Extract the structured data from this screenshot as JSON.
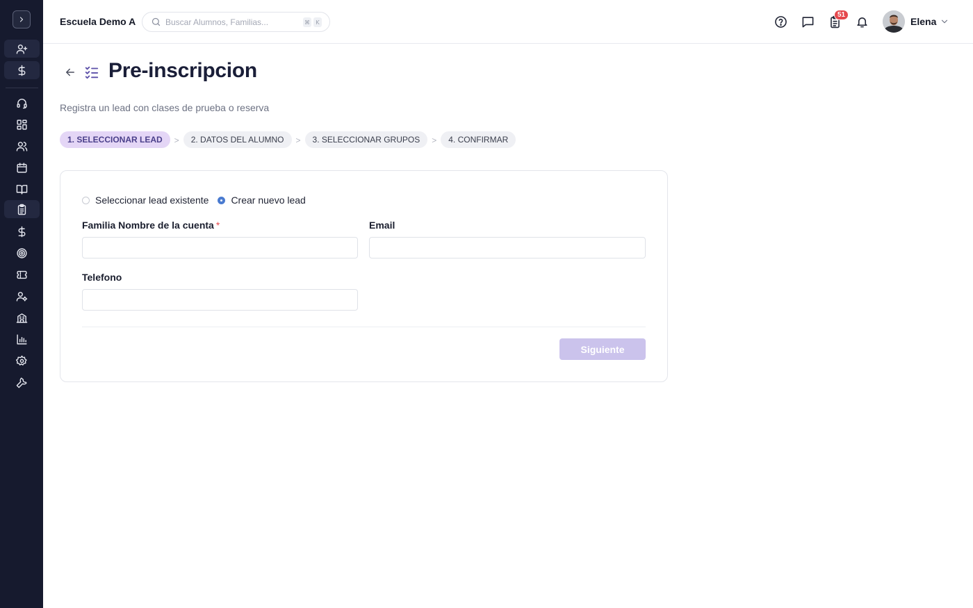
{
  "header": {
    "school_name": "Escuela Demo A",
    "search_placeholder": "Buscar Alumnos, Familias...",
    "search_shortcut": [
      "⌘",
      "K"
    ],
    "notification_count": "51",
    "user_name": "Elena"
  },
  "sidebar": {
    "items": [
      {
        "icon": "user-plus-icon"
      },
      {
        "icon": "dollar-icon"
      },
      {
        "icon": "headset-icon"
      },
      {
        "icon": "dashboard-grid-icon"
      },
      {
        "icon": "users-icon"
      },
      {
        "icon": "calendar-icon"
      },
      {
        "icon": "book-open-icon"
      },
      {
        "icon": "clipboard-list-icon",
        "active": true
      },
      {
        "icon": "dollar-icon"
      },
      {
        "icon": "target-icon"
      },
      {
        "icon": "ticket-icon"
      },
      {
        "icon": "user-gear-icon"
      },
      {
        "icon": "building-icon"
      },
      {
        "icon": "bar-chart-icon"
      },
      {
        "icon": "settings-gear-icon"
      },
      {
        "icon": "wrench-icon"
      }
    ]
  },
  "page": {
    "title": "Pre-inscripcion",
    "subtitle": "Registra un lead con clases de prueba o reserva"
  },
  "steps": [
    {
      "label": "1. SELECCIONAR LEAD",
      "active": true
    },
    {
      "label": "2. DATOS DEL ALUMNO",
      "active": false
    },
    {
      "label": "3. SELECCIONAR GRUPOS",
      "active": false
    },
    {
      "label": "4. CONFIRMAR",
      "active": false
    }
  ],
  "step_separator": ">",
  "form": {
    "radio_existing": "Seleccionar lead existente",
    "radio_new": "Crear nuevo lead",
    "selected_option": "new",
    "family_label": "Familia Nombre de la cuenta",
    "required_mark": "*",
    "family_value": "",
    "email_label": "Email",
    "email_value": "",
    "phone_label": "Telefono",
    "phone_value": "",
    "next_label": "Siguiente"
  },
  "colors": {
    "sidebar_bg": "#161a2e",
    "accent_purple": "#e4d6f6",
    "button_disabled": "#cbc3ec",
    "radio_selected": "#4a7bd0",
    "badge_red": "#e5484d"
  }
}
